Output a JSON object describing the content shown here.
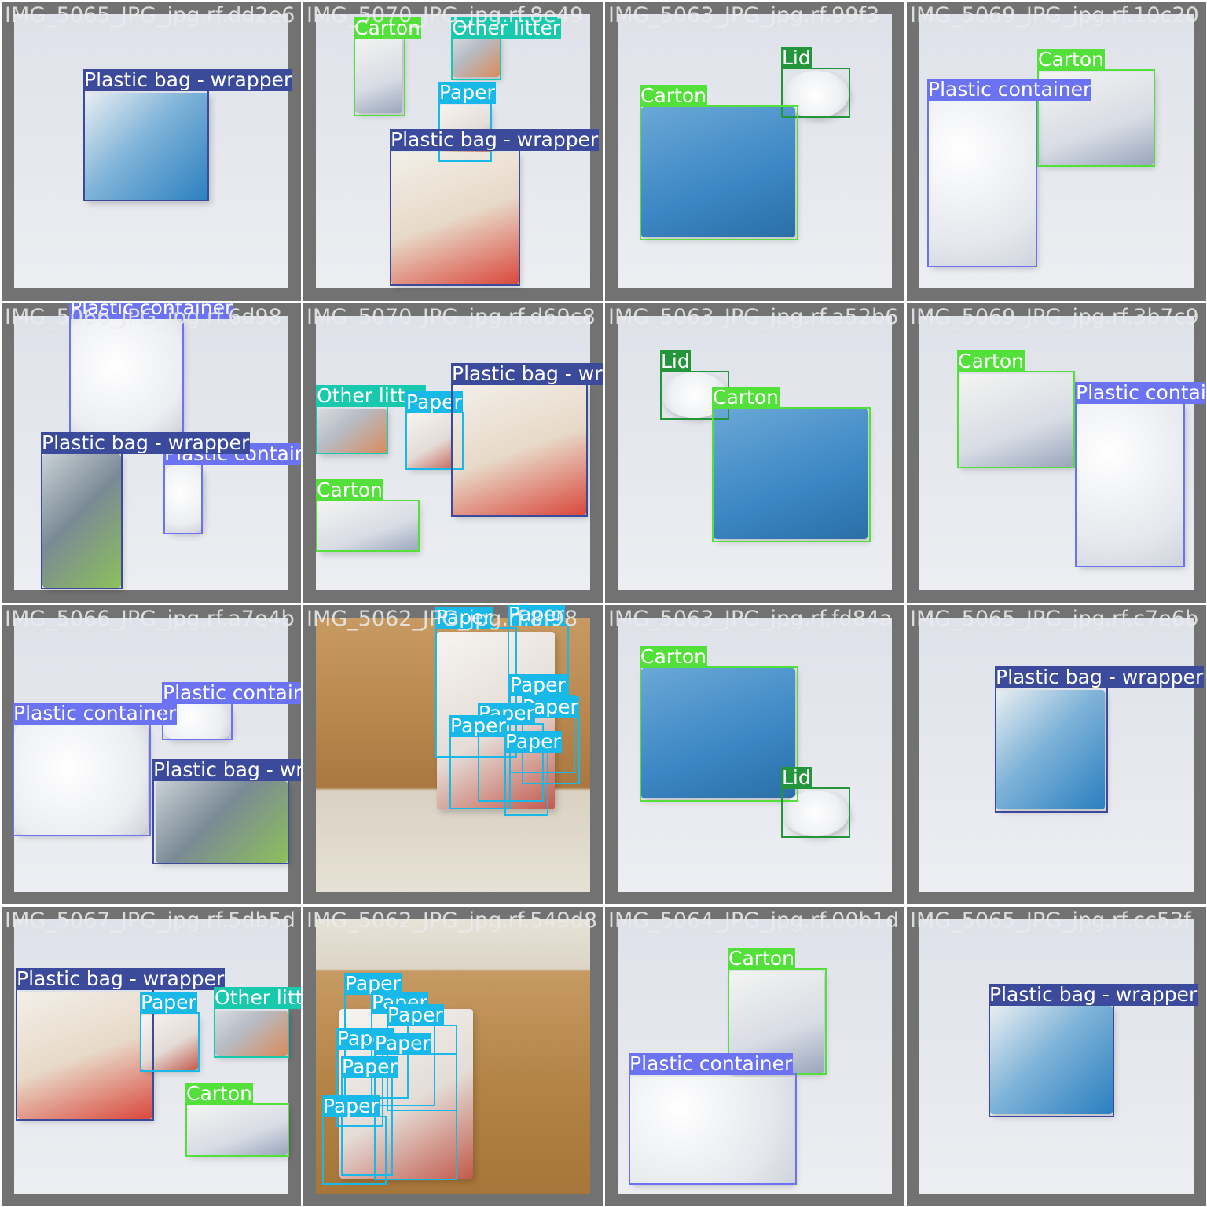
{
  "tiles": [
    {
      "filename": "IMG_5065_JPG_jpg.rf.dd2e6",
      "labels": [
        "Plastic bag - wrapper"
      ]
    },
    {
      "filename": "IMG_5070_JPG_jpg.rf.8e49",
      "labels": [
        "Carton",
        "Other litter",
        "Paper",
        "Plastic bag - wrapper"
      ]
    },
    {
      "filename": "IMG_5063_JPG_jpg.rf.99f3",
      "labels": [
        "Lid",
        "Carton"
      ]
    },
    {
      "filename": "IMG_5069_JPG_jpg.rf.10c20",
      "labels": [
        "Carton",
        "Plastic container"
      ]
    },
    {
      "filename": "IMG_5066_JPG_jpg.rf.6d98",
      "labels": [
        "Plastic container",
        "Plastic bag - wrapper",
        "Plastic container"
      ]
    },
    {
      "filename": "IMG_5070_JPG_jpg.rf.d69c8",
      "labels": [
        "Other litter",
        "Paper",
        "Plastic bag - wrapper",
        "Carton"
      ]
    },
    {
      "filename": "IMG_5063_JPG_jpg.rf.a52b6",
      "labels": [
        "Lid",
        "Carton"
      ]
    },
    {
      "filename": "IMG_5069_JPG_jpg.rf.3b7c9",
      "labels": [
        "Carton",
        "Plastic container"
      ]
    },
    {
      "filename": "IMG_5066_JPG_jpg.rf.a7e4b",
      "labels": [
        "Plastic container",
        "Plastic container",
        "Plastic bag - wrapper"
      ]
    },
    {
      "filename": "IMG_5062_JPG_jpg.rf.8f98",
      "labels": [
        "Paper",
        "Paper",
        "Paper",
        "Paper",
        "Paper",
        "Paper",
        "Paper"
      ]
    },
    {
      "filename": "IMG_5063_JPG_jpg.rf.fd84a",
      "labels": [
        "Carton",
        "Lid"
      ]
    },
    {
      "filename": "IMG_5065_JPG_jpg.rf.c7e6b",
      "labels": [
        "Plastic bag - wrapper"
      ]
    },
    {
      "filename": "IMG_5067_JPG_jpg.rf.5db5d",
      "labels": [
        "Plastic bag - wrapper",
        "Paper",
        "Other litter",
        "Carton"
      ]
    },
    {
      "filename": "IMG_5062_JPG_jpg.rf.549d8",
      "labels": [
        "Paper",
        "Paper",
        "Paper",
        "Paper",
        "Paper",
        "Paper",
        "Paper"
      ]
    },
    {
      "filename": "IMG_5064_JPG_jpg.rf.00b1d",
      "labels": [
        "Carton",
        "Plastic container"
      ]
    },
    {
      "filename": "IMG_5065_JPG_jpg.rf.cc53f",
      "labels": [
        "Plastic bag - wrapper"
      ]
    }
  ]
}
